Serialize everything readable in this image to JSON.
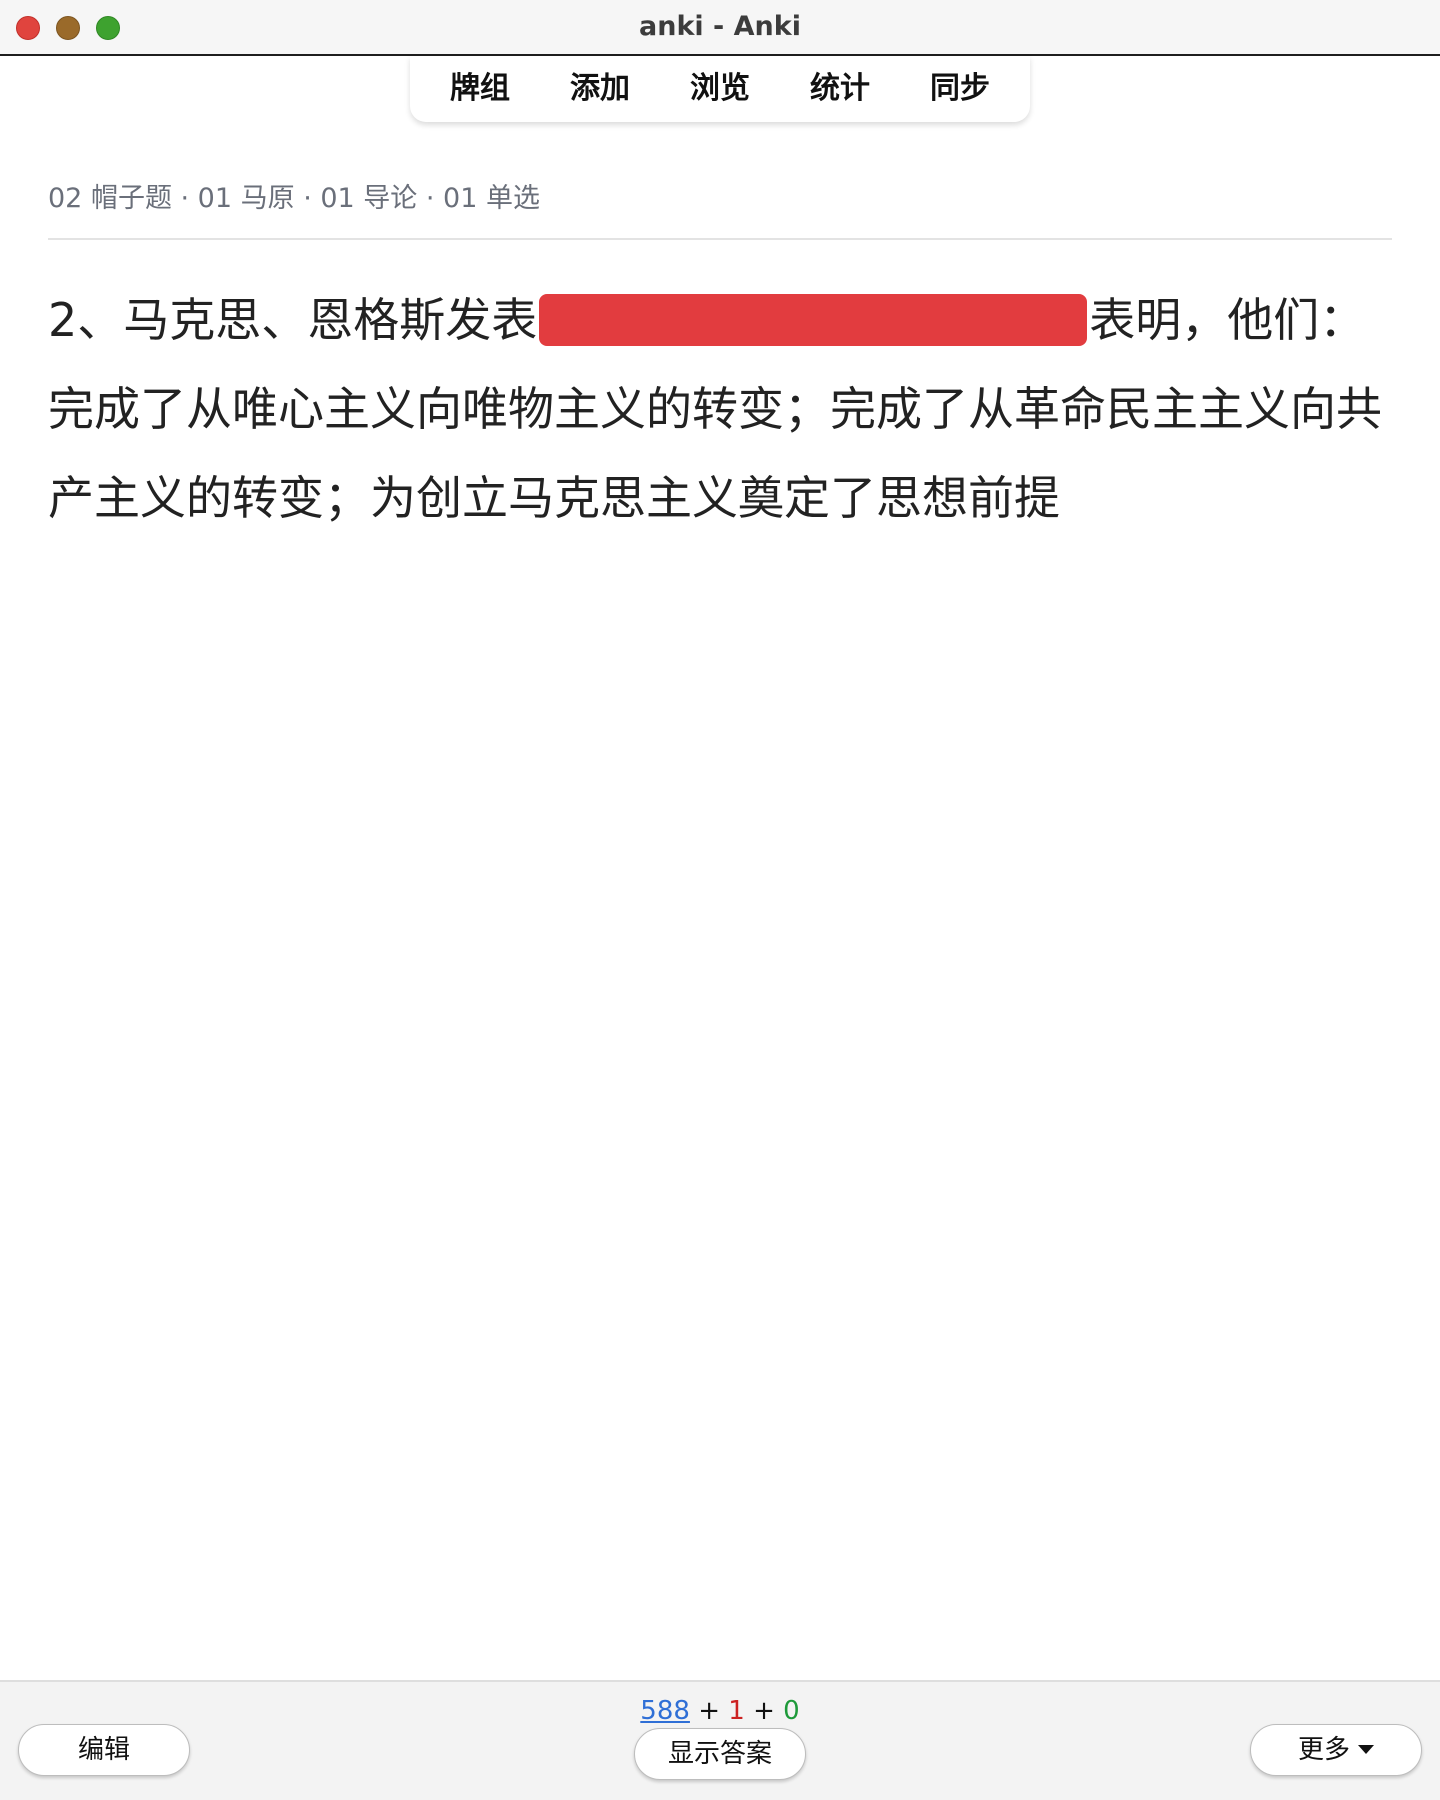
{
  "window": {
    "title": "anki - Anki"
  },
  "toolbar": {
    "items": [
      {
        "label": "牌组"
      },
      {
        "label": "添加"
      },
      {
        "label": "浏览"
      },
      {
        "label": "统计"
      },
      {
        "label": "同步"
      }
    ]
  },
  "card": {
    "deck_path": "02 帽子题 · 01 马原 · 01 导论 · 01 单选",
    "question_before_cloze": "2、马克思、恩格斯发表",
    "question_after_cloze": "表明，他们：完成了从唯心主义向唯物主义的转变；完成了从革命民主主义向共产主义的转变；为创立马克思主义奠定了思想前提",
    "cloze_color": "#e23c3f"
  },
  "bottom": {
    "counts": {
      "new": "588",
      "learning": "1",
      "review": "0",
      "separator": "+"
    },
    "edit_label": "编辑",
    "show_answer_label": "显示答案",
    "more_label": "更多"
  }
}
